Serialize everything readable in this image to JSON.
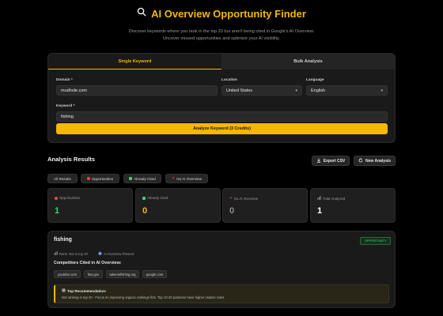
{
  "header": {
    "title": "AI Overview Opportunity Finder",
    "subtitle": "Discover keywords where you rank in the top 20 but aren't being cited in Google's AI Overview. Uncover missed opportunities and optimize your AI visibility."
  },
  "tabs": [
    {
      "label": "Single Keyword",
      "active": true
    },
    {
      "label": "Bulk Analysis",
      "active": false
    }
  ],
  "form": {
    "domain_label": "Domain *",
    "domain_value": "mudhole.com",
    "location_label": "Location",
    "location_value": "United States",
    "language_label": "Language",
    "language_value": "English",
    "keyword_label": "Keyword *",
    "keyword_value": "fishing",
    "analyze_label": "Analyze Keyword (3 Credits)"
  },
  "results": {
    "title": "Analysis Results",
    "export_label": "Export CSV",
    "new_label": "New Analysis",
    "filters": [
      {
        "label": "All Results"
      },
      {
        "label": "Opportunities"
      },
      {
        "label": "Already Cited"
      },
      {
        "label": "No AI Overview"
      }
    ],
    "stats": [
      {
        "label": "Opportunities",
        "value": "1",
        "color": "#3fd36b"
      },
      {
        "label": "Already Cited",
        "value": "0",
        "color": "#f5b800"
      },
      {
        "label": "No AI Overview",
        "value": "0",
        "color": "#8a8a8a"
      },
      {
        "label": "Total Analyzed",
        "value": "1",
        "color": "#ffffff"
      }
    ]
  },
  "keyword_card": {
    "keyword": "fishing",
    "badge": "OPPORTUNITY",
    "rank": "Rank: Not in top 20",
    "ai_overview": "AI Overview Present",
    "competitors_title": "Competitors Cited in AI Overview:",
    "competitors": [
      "youtube.com",
      "fws.gov",
      "takemefishing.org",
      "google.com"
    ],
    "recommendation_title": "Top Recommendation:",
    "recommendation_text": "Not ranking in top 20 - Focus on improving organic rankings first. Top 10-20 positions have higher citation rates."
  },
  "colors": {
    "accent": "#f5b800",
    "success": "#3fd36b",
    "muted": "#8a8a8a"
  }
}
